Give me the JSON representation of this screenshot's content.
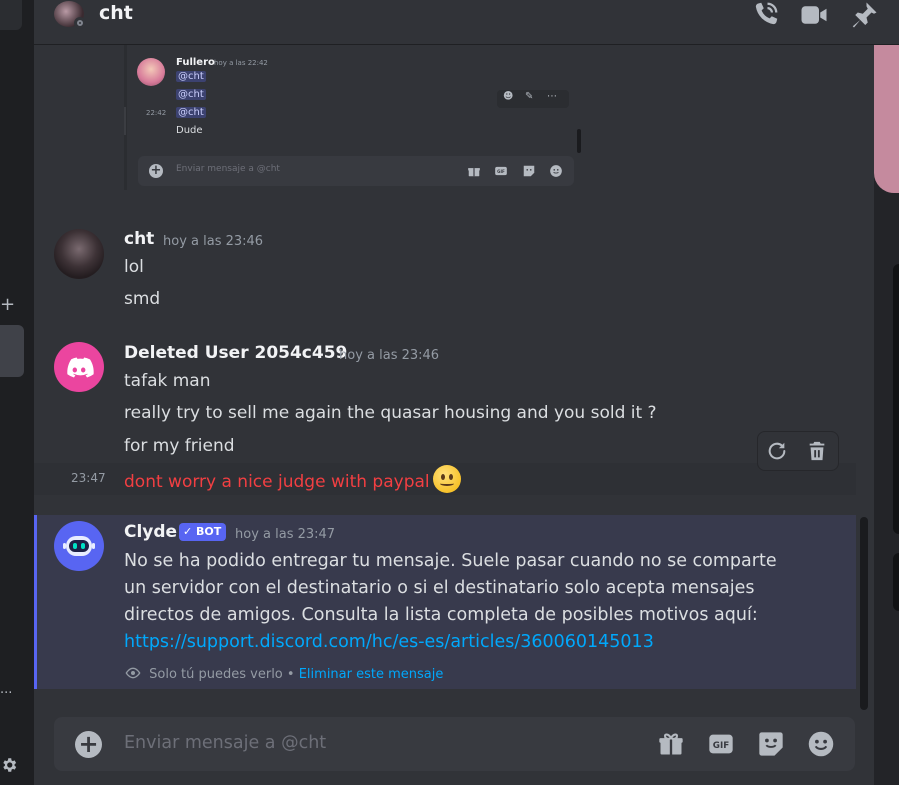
{
  "header": {
    "title": "cht",
    "icons": [
      "phone-call-icon",
      "video-camera-icon",
      "pin-icon"
    ]
  },
  "embedded_screenshot": {
    "author": "Fullero",
    "timestamp": "hoy a las 22:42",
    "mentions": [
      "@cht",
      "@cht",
      "@cht"
    ],
    "side_time": "22:42",
    "last_line": "Dude",
    "hover_icons": [
      "☻",
      "✎",
      "⋯"
    ],
    "input_placeholder": "Enviar mensaje a @cht",
    "input_icons": [
      "gift-icon",
      "gif-icon",
      "sticker-icon",
      "emoji-icon"
    ]
  },
  "messages": {
    "cht": {
      "author": "cht",
      "timestamp": "hoy a las 23:46",
      "lines": [
        "lol",
        "smd"
      ]
    },
    "deleted": {
      "author": "Deleted User 2054c459",
      "timestamp": "hoy a las 23:46",
      "lines": [
        "tafak man",
        "really try to sell me again the quasar housing and you sold it ?",
        "for my friend"
      ],
      "failed_line": "dont worry a nice judge with paypal",
      "failed_time": "23:47",
      "failed_color": "#f23f42",
      "actions": [
        "retry-icon",
        "trash-icon"
      ]
    },
    "clyde": {
      "author": "Clyde",
      "badge": "BOT",
      "timestamp": "hoy a las 23:47",
      "body": "No se ha podido entregar tu mensaje. Suele pasar cuando no se comparte un servidor con el destinatario o si el destinatario solo acepta mensajes directos de amigos. Consulta la lista completa de posibles motivos aquí:",
      "link": "https://support.discord.com/hc/es-es/articles/360060145013",
      "ephemeral_text": "Solo tú puedes verlo",
      "ephemeral_sep": "•",
      "dismiss_link": "Eliminar este mensaje"
    }
  },
  "composer": {
    "placeholder": "Enviar mensaje a @cht",
    "icons": [
      "gift-icon",
      "gif-icon",
      "sticker-icon",
      "emoji-icon"
    ]
  },
  "sidebar": {
    "plus": "+",
    "dots": "..."
  },
  "colors": {
    "background": "#313338",
    "accent": "#5865f2",
    "link": "#00a8fc",
    "error": "#f23f42",
    "deleted_avatar": "#eb459f"
  }
}
